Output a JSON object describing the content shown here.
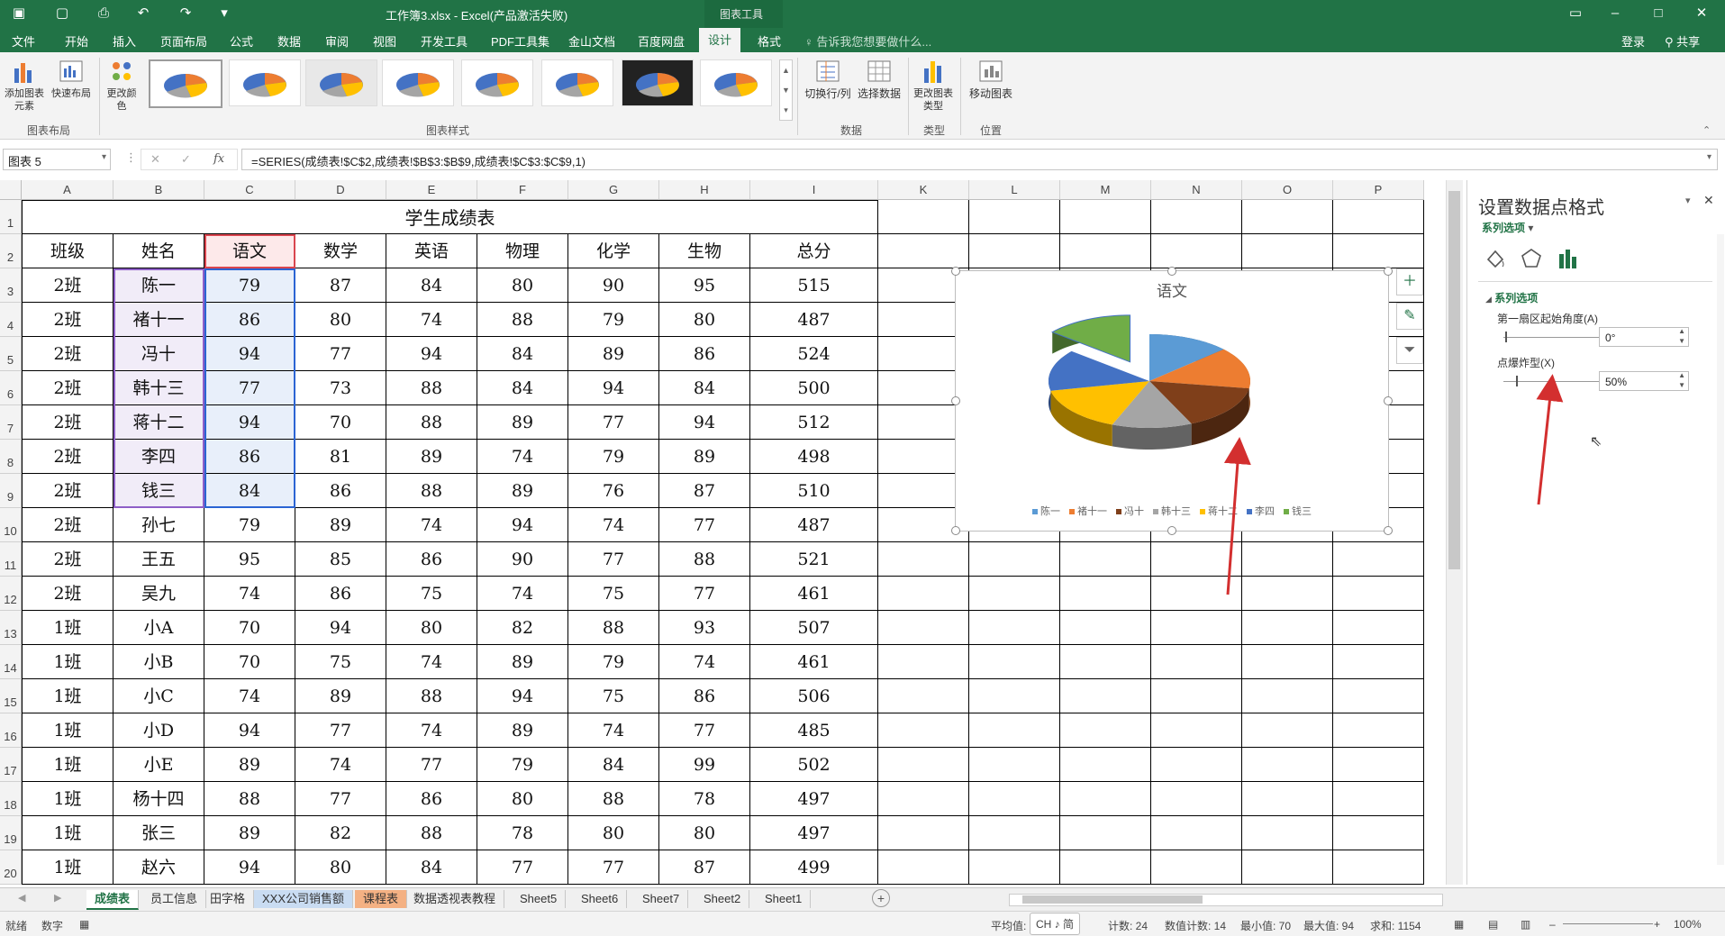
{
  "titlebar": {
    "filename": "工作簿3.xlsx - Excel(产品激活失败)",
    "context_tab": "图表工具",
    "login": "登录",
    "share": "共享",
    "tellme": "告诉我您想要做什么..."
  },
  "menus": [
    "文件",
    "开始",
    "插入",
    "页面布局",
    "公式",
    "数据",
    "审阅",
    "视图",
    "开发工具",
    "PDF工具集",
    "金山文档",
    "百度网盘",
    "设计",
    "格式"
  ],
  "active_menu": "设计",
  "ribbon": {
    "add_element": "添加图表元素",
    "quick_layout": "快速布局",
    "change_color": "更改颜色",
    "switch_row_col": "切换行/列",
    "select_data": "选择数据",
    "change_type": "更改图表类型",
    "move_chart": "移动图表",
    "group_layout": "图表布局",
    "group_styles": "图表样式",
    "group_data": "数据",
    "group_type": "类型",
    "group_position": "位置"
  },
  "formula": {
    "namebox": "图表 5",
    "fx": "fx",
    "content": "=SERIES(成绩表!$C$2,成绩表!$B$3:$B$9,成绩表!$C$3:$C$9,1)"
  },
  "columns": [
    "A",
    "B",
    "C",
    "D",
    "E",
    "F",
    "G",
    "H",
    "I",
    "K",
    "L",
    "M",
    "N",
    "O",
    "P"
  ],
  "sheet": {
    "title": "学生成绩表",
    "headers": [
      "班级",
      "姓名",
      "语文",
      "数学",
      "英语",
      "物理",
      "化学",
      "生物",
      "总分"
    ],
    "rows": [
      [
        "2班",
        "陈一",
        "79",
        "87",
        "84",
        "80",
        "90",
        "95",
        "515"
      ],
      [
        "2班",
        "褚十一",
        "86",
        "80",
        "74",
        "88",
        "79",
        "80",
        "487"
      ],
      [
        "2班",
        "冯十",
        "94",
        "77",
        "94",
        "84",
        "89",
        "86",
        "524"
      ],
      [
        "2班",
        "韩十三",
        "77",
        "73",
        "88",
        "84",
        "94",
        "84",
        "500"
      ],
      [
        "2班",
        "蒋十二",
        "94",
        "70",
        "88",
        "89",
        "77",
        "94",
        "512"
      ],
      [
        "2班",
        "李四",
        "86",
        "81",
        "89",
        "74",
        "79",
        "89",
        "498"
      ],
      [
        "2班",
        "钱三",
        "84",
        "86",
        "88",
        "89",
        "76",
        "87",
        "510"
      ],
      [
        "2班",
        "孙七",
        "79",
        "89",
        "74",
        "94",
        "74",
        "77",
        "487"
      ],
      [
        "2班",
        "王五",
        "95",
        "85",
        "86",
        "90",
        "77",
        "88",
        "521"
      ],
      [
        "2班",
        "吴九",
        "74",
        "86",
        "75",
        "74",
        "75",
        "77",
        "461"
      ],
      [
        "1班",
        "小A",
        "70",
        "94",
        "80",
        "82",
        "88",
        "93",
        "507"
      ],
      [
        "1班",
        "小B",
        "70",
        "75",
        "74",
        "89",
        "79",
        "74",
        "461"
      ],
      [
        "1班",
        "小C",
        "74",
        "89",
        "88",
        "94",
        "75",
        "86",
        "506"
      ],
      [
        "1班",
        "小D",
        "94",
        "77",
        "74",
        "89",
        "74",
        "77",
        "485"
      ],
      [
        "1班",
        "小E",
        "89",
        "74",
        "77",
        "79",
        "84",
        "99",
        "502"
      ],
      [
        "1班",
        "杨十四",
        "88",
        "77",
        "86",
        "80",
        "88",
        "78",
        "497"
      ],
      [
        "1班",
        "张三",
        "89",
        "82",
        "88",
        "78",
        "80",
        "80",
        "497"
      ],
      [
        "1班",
        "赵六",
        "94",
        "80",
        "84",
        "77",
        "77",
        "87",
        "499"
      ]
    ]
  },
  "chart_data": {
    "type": "pie",
    "title": "语文",
    "categories": [
      "陈一",
      "褚十一",
      "冯十",
      "韩十三",
      "蒋十二",
      "李四",
      "钱三"
    ],
    "values": [
      79,
      86,
      94,
      77,
      94,
      86,
      84
    ],
    "colors": [
      "#5b9bd5",
      "#ed7d31",
      "#7f3f1a",
      "#a5a5a5",
      "#ffc000",
      "#4472c4",
      "#70ad47",
      "#264478"
    ],
    "exploded_point": "钱三",
    "legend_position": "bottom"
  },
  "pane": {
    "title": "设置数据点格式",
    "subtitle": "系列选项",
    "section": "系列选项",
    "angle_label": "第一扇区起始角度(A)",
    "angle_value": "0°",
    "explode_label": "点爆炸型(X)",
    "explode_value": "50%"
  },
  "tabs": [
    "成绩表",
    "员工信息",
    "田字格",
    "XXX公司销售额",
    "课程表",
    "数据透视表教程",
    "Sheet5",
    "Sheet6",
    "Sheet7",
    "Sheet2",
    "Sheet1"
  ],
  "active_tab": "成绩表",
  "status": {
    "ready": "就绪",
    "num": "数字",
    "avg": "平均值:",
    "ime": "CH ♪ 简",
    "count": "计数: 24",
    "numcount": "数值计数: 14",
    "min": "最小值: 70",
    "max": "最大值: 94",
    "sum": "求和: 1154",
    "zoom": "100%"
  }
}
